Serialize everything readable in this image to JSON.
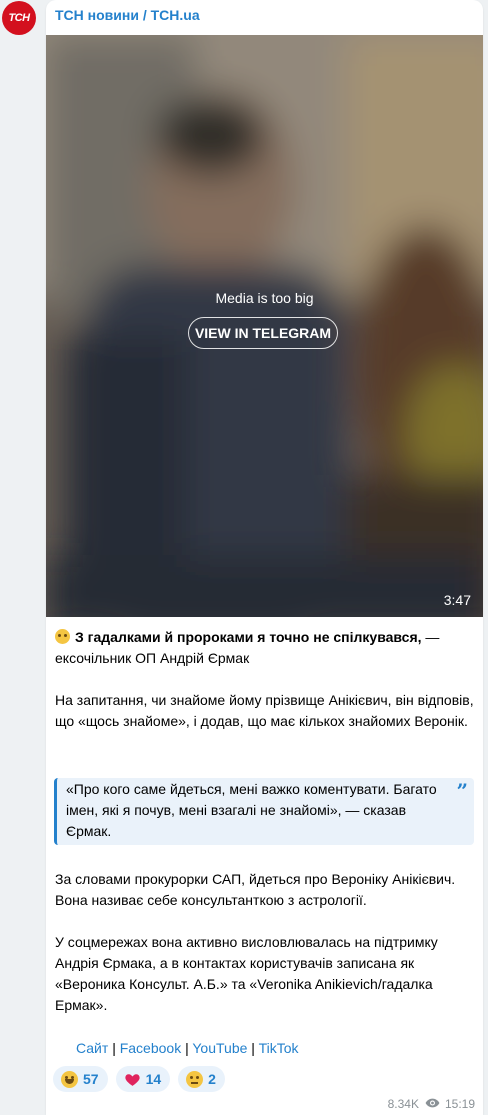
{
  "channel": {
    "avatar_text": "TCH",
    "name": "ТСН новини / TCH.ua"
  },
  "media": {
    "message": "Media is too big",
    "button_label": "VIEW IN TELEGRAM",
    "duration": "3:47"
  },
  "post": {
    "lead_bold": "З гадалками й пророками я точно не спілкувався,",
    "lead_rest": " — ексочільник ОП Андрій Єрмак",
    "para1": "На запитання, чи знайоме йому прізвище Анікієвич, він відповів, що «щось знайоме», і додав, що має кількох знайомих Веронік.",
    "quote": "«Про кого саме йдеться, мені важко коментувати. Багато імен, які я почув, мені взагалі не знайомі», — сказав Єрмак.",
    "para2": "За словами прокурорки САП, йдеться про Вероніку Анікієвич. Вона називає себе консультанткою з астрології.",
    "para3": "У соцмережах вона активно висловлювалась на підтримку Андрія Єрмака, а в контактах користувачів записана як «Вероника Консульт. А.Б.» та «Veronika Anikievich/гадалка Ермак»."
  },
  "links": {
    "items": [
      "Сайт",
      "Facebook",
      "YouTube",
      "TikTok"
    ],
    "separator": "|"
  },
  "reactions": [
    {
      "icon": "smiling-face-icon",
      "count": "57"
    },
    {
      "icon": "red-heart-icon",
      "count": "14"
    },
    {
      "icon": "neutral-face-icon",
      "count": "2"
    }
  ],
  "meta": {
    "views": "8.34K",
    "time": "15:19"
  },
  "colors": {
    "accent": "#2481cc",
    "avatar_bg": "#d3101e",
    "background": "#eef1f3"
  }
}
